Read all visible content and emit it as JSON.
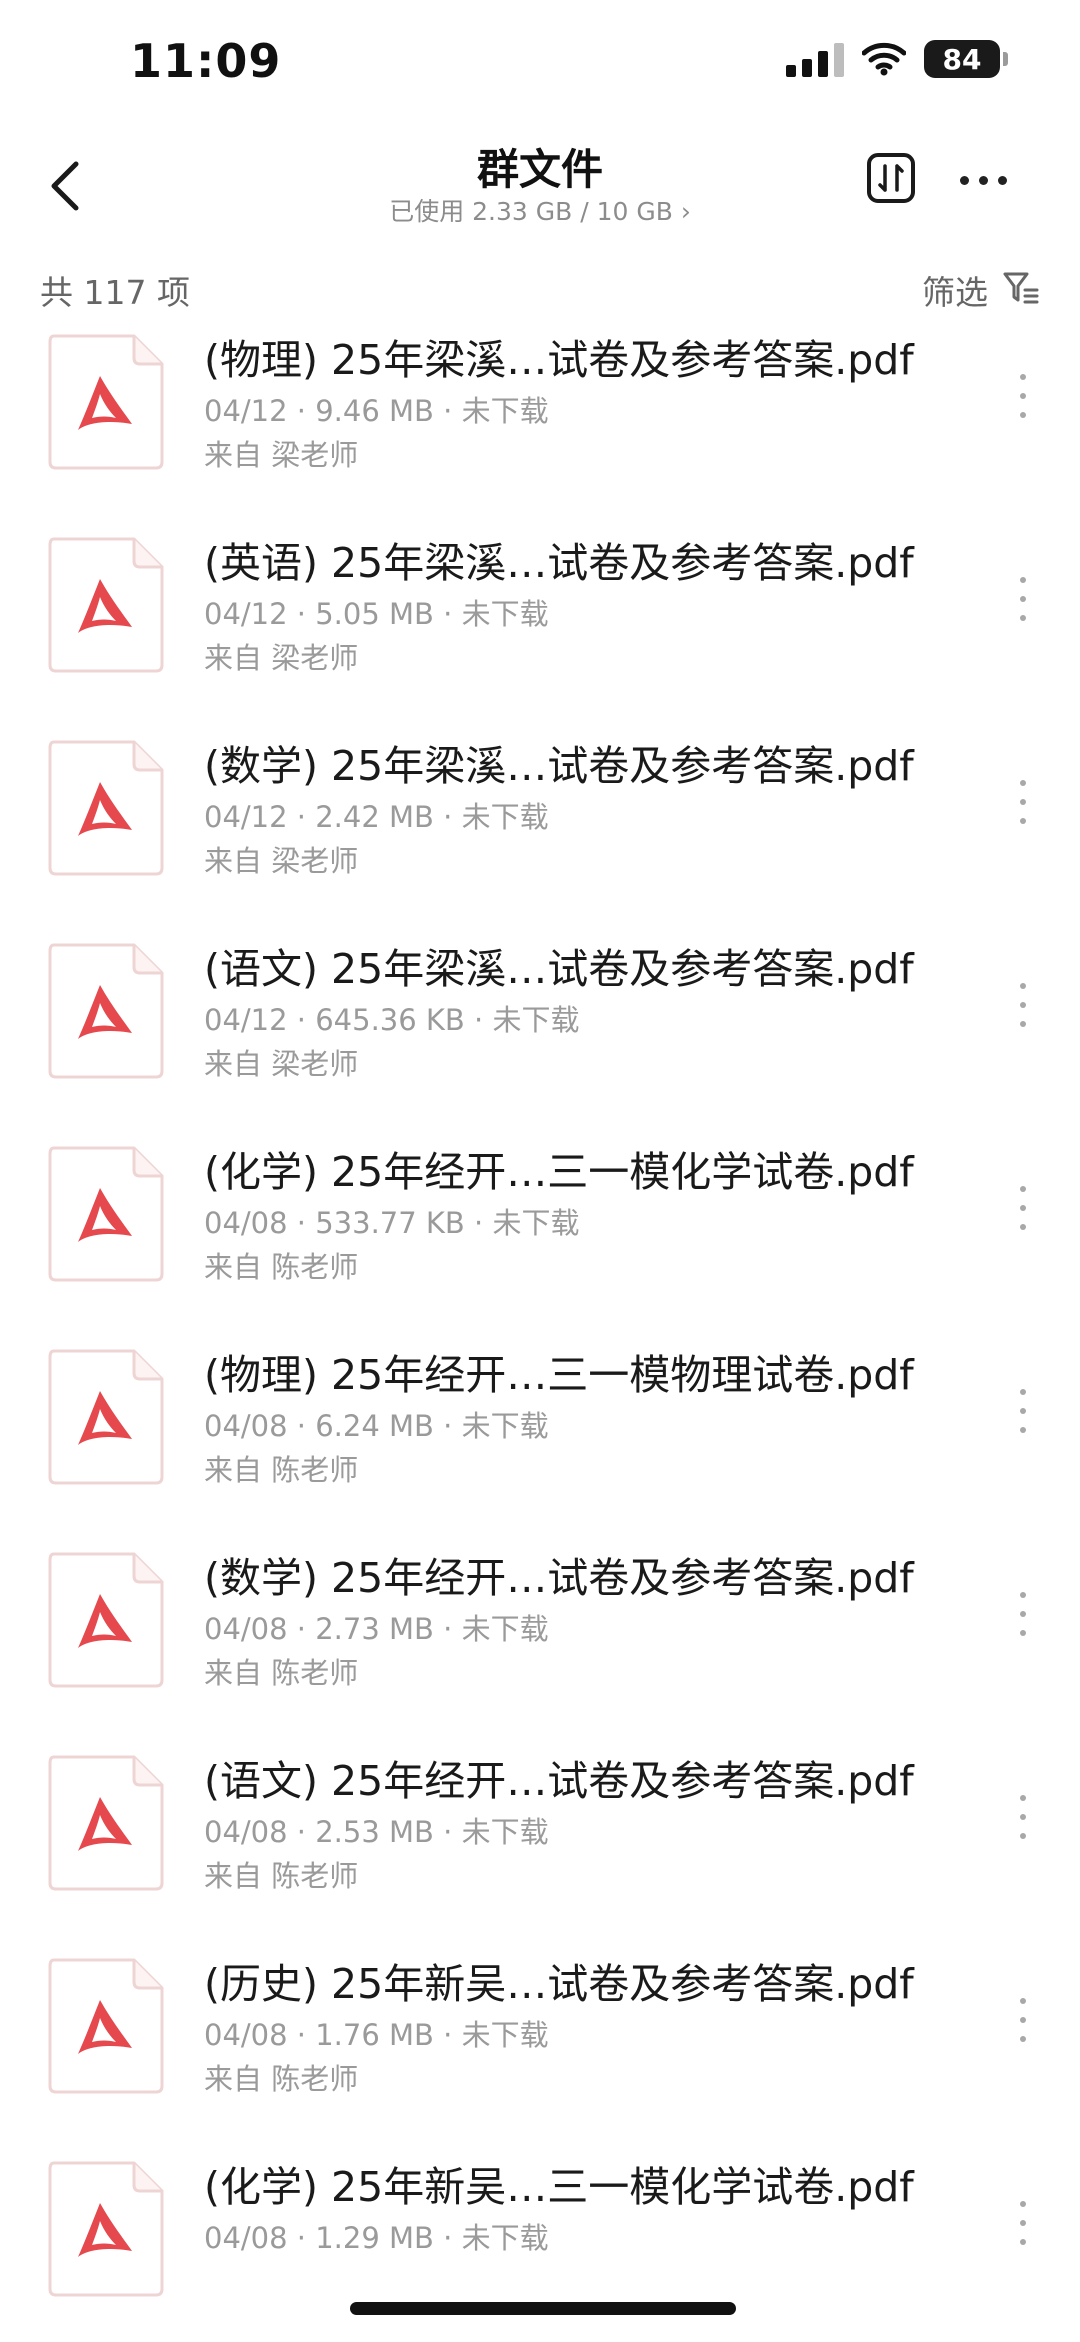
{
  "status_bar": {
    "time": "11:09",
    "battery": "84"
  },
  "header": {
    "back_icon": "chevron-left-icon",
    "title": "群文件",
    "storage": "已使用 2.33 GB / 10 GB ›",
    "sort_icon": "sort-icon",
    "more_icon": "more-horizontal-icon"
  },
  "summary": {
    "count_label": "共 117 项",
    "filter_label": "筛选",
    "filter_icon": "filter-icon"
  },
  "files": [
    {
      "name": "(物理) 25年梁溪…试卷及参考答案.pdf",
      "meta": "04/12 · 9.46 MB · 未下载",
      "source": "来自 梁老师"
    },
    {
      "name": "(英语) 25年梁溪…试卷及参考答案.pdf",
      "meta": "04/12 · 5.05 MB · 未下载",
      "source": "来自 梁老师"
    },
    {
      "name": "(数学) 25年梁溪…试卷及参考答案.pdf",
      "meta": "04/12 · 2.42 MB · 未下载",
      "source": "来自 梁老师"
    },
    {
      "name": "(语文) 25年梁溪…试卷及参考答案.pdf",
      "meta": "04/12 · 645.36 KB · 未下载",
      "source": "来自 梁老师"
    },
    {
      "name": "(化学) 25年经开…三一模化学试卷.pdf",
      "meta": "04/08 · 533.77 KB · 未下载",
      "source": "来自 陈老师"
    },
    {
      "name": "(物理) 25年经开…三一模物理试卷.pdf",
      "meta": "04/08 · 6.24 MB · 未下载",
      "source": "来自 陈老师"
    },
    {
      "name": "(数学) 25年经开…试卷及参考答案.pdf",
      "meta": "04/08 · 2.73 MB · 未下载",
      "source": "来自 陈老师"
    },
    {
      "name": "(语文) 25年经开…试卷及参考答案.pdf",
      "meta": "04/08 · 2.53 MB · 未下载",
      "source": "来自 陈老师"
    },
    {
      "name": "(历史) 25年新吴…试卷及参考答案.pdf",
      "meta": "04/08 · 1.76 MB · 未下载",
      "source": "来自 陈老师"
    },
    {
      "name": "(化学) 25年新吴…三一模化学试卷.pdf",
      "meta": "04/08 · 1.29 MB · 未下载",
      "source": ""
    }
  ],
  "colors": {
    "pdf_red": "#e5484d",
    "icon_border": "#efd4d4"
  }
}
